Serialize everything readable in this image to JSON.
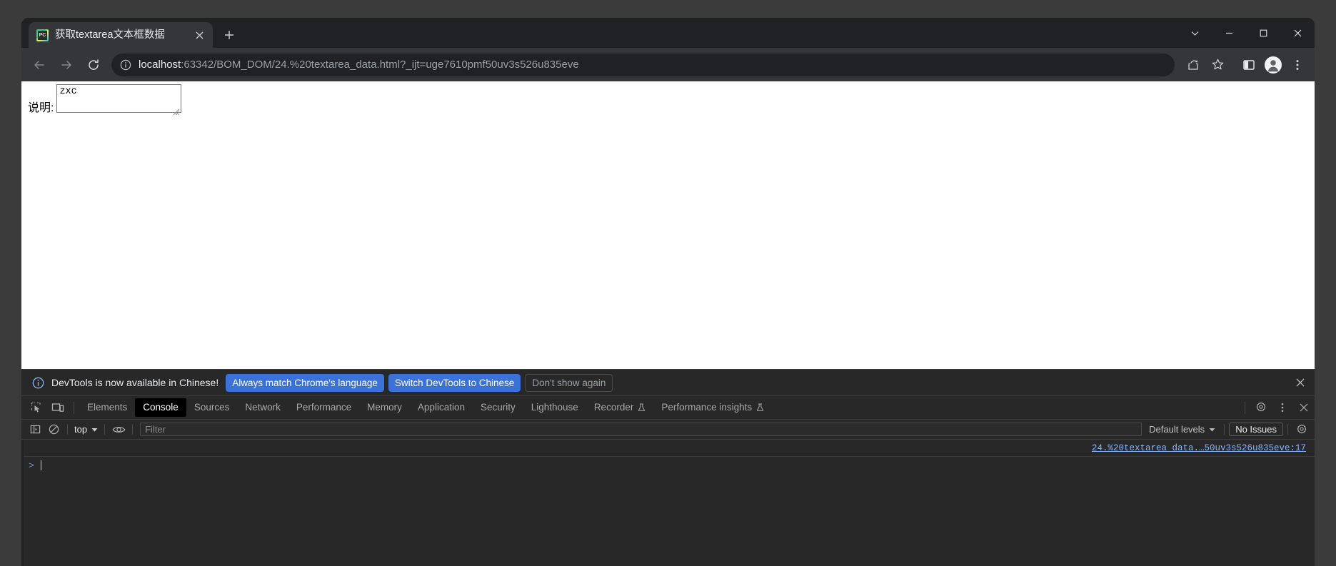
{
  "window": {
    "controls": {
      "tab_search": "chevron-down",
      "minimize": "minimize",
      "maximize": "maximize",
      "close": "close"
    }
  },
  "tabstrip": {
    "tabs": [
      {
        "title": "获取textarea文本框数据",
        "favicon": "pycharm-icon",
        "active": true
      }
    ],
    "new_tab_label": "+"
  },
  "toolbar": {
    "back": "back-arrow",
    "forward": "forward-arrow",
    "reload": "reload-icon",
    "omnibox": {
      "info_icon": "info-circle-icon",
      "host": "localhost",
      "path": ":63342/BOM_DOM/24.%20textarea_data.html?_ijt=uge7610pmf50uv3s526u835eve",
      "full_url": "localhost:63342/BOM_DOM/24.%20textarea_data.html?_ijt=uge7610pmf50uv3s526u835eve"
    },
    "actions": [
      "share-icon",
      "bookmark-star-icon",
      "side-panel-icon",
      "profile-avatar-icon",
      "more-menu-icon"
    ]
  },
  "page": {
    "label": "说明:",
    "textarea_value": "zxc"
  },
  "devtools": {
    "banner": {
      "icon": "info-circle-icon",
      "message": "DevTools is now available in Chinese!",
      "primary_button": "Always match Chrome's language",
      "secondary_button": "Switch DevTools to Chinese",
      "dismiss_button": "Don't show again",
      "close_icon": "close-icon"
    },
    "tabbar": {
      "inspect_icon": "inspect-element-icon",
      "device_icon": "device-toolbar-icon",
      "tabs": [
        {
          "label": "Elements",
          "active": false,
          "flask": false
        },
        {
          "label": "Console",
          "active": true,
          "flask": false
        },
        {
          "label": "Sources",
          "active": false,
          "flask": false
        },
        {
          "label": "Network",
          "active": false,
          "flask": false
        },
        {
          "label": "Performance",
          "active": false,
          "flask": false
        },
        {
          "label": "Memory",
          "active": false,
          "flask": false
        },
        {
          "label": "Application",
          "active": false,
          "flask": false
        },
        {
          "label": "Security",
          "active": false,
          "flask": false
        },
        {
          "label": "Lighthouse",
          "active": false,
          "flask": false
        },
        {
          "label": "Recorder",
          "active": false,
          "flask": true
        },
        {
          "label": "Performance insights",
          "active": false,
          "flask": true
        }
      ],
      "settings_icon": "gear-icon",
      "more_icon": "more-menu-icon",
      "close_icon": "close-icon"
    },
    "console_toolbar": {
      "sidebar_icon": "console-sidebar-icon",
      "clear_icon": "clear-console-icon",
      "context": "top",
      "eye_icon": "live-expression-icon",
      "filter_placeholder": "Filter",
      "filter_value": "",
      "levels": "Default levels",
      "issues": "No Issues",
      "settings_icon": "gear-icon"
    },
    "console": {
      "source_link": "24.%20textarea_data.…50uv3s526u835eve:17",
      "prompt_chevron": ">"
    }
  },
  "colors": {
    "chrome_frame": "#202124",
    "tab_active": "#35363a",
    "toolbar": "#35363a",
    "omnibox": "#202124",
    "devtools_bg": "#282828",
    "accent_blue": "#3b72d9",
    "link_blue": "#8ab4f8",
    "text_primary": "#e8eaed",
    "text_secondary": "#9aa0a6",
    "page_bg": "#ffffff",
    "desktop": "#3b3b3b"
  }
}
